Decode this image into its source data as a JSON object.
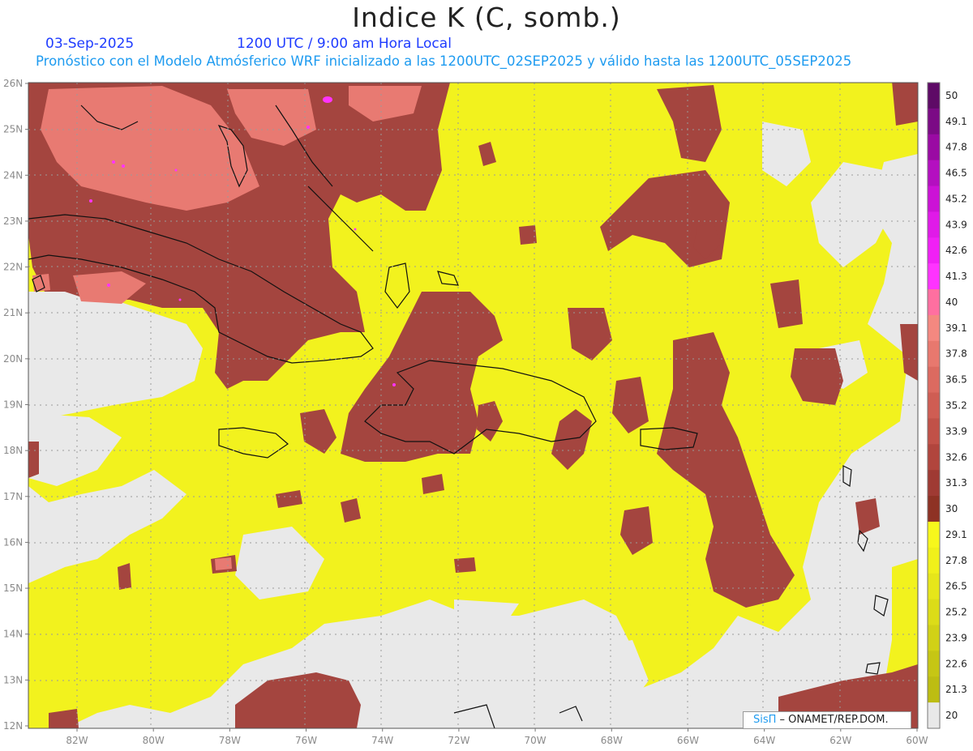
{
  "header": {
    "title": "Indice K (C, somb.)",
    "date": "03-Sep-2025",
    "time": "1200 UTC / 9:00 am Hora Local",
    "forecast": "Pronóstico con el Modelo Atmósferico WRF inicializado a las 1200UTC_02SEP2025 y válido hasta las  1200UTC_05SEP2025"
  },
  "map": {
    "lat_labels": [
      "26N",
      "25N",
      "24N",
      "23N",
      "22N",
      "21N",
      "20N",
      "19N",
      "18N",
      "17N",
      "16N",
      "15N",
      "14N",
      "13N",
      "12N"
    ],
    "lon_labels": [
      "82W",
      "80W",
      "78W",
      "76W",
      "74W",
      "72W",
      "70W",
      "68W",
      "66W",
      "64W",
      "62W",
      "60W"
    ],
    "background_color": "#e9e9e9",
    "moderate_color": "#f2f21e",
    "high_color": "#a4453f",
    "very_high_color": "#e87a72"
  },
  "colorbar": {
    "labels": [
      "50",
      "49.1",
      "47.8",
      "46.5",
      "45.2",
      "43.9",
      "42.6",
      "41.3",
      "40",
      "39.1",
      "37.8",
      "36.5",
      "35.2",
      "33.9",
      "32.6",
      "31.3",
      "30",
      "29.1",
      "27.8",
      "26.5",
      "25.2",
      "23.9",
      "22.6",
      "21.3",
      "20"
    ],
    "colors": [
      "#5e0a66",
      "#7b0a85",
      "#9a0aa3",
      "#b40fc0",
      "#cc12d6",
      "#e01ae8",
      "#f020f5",
      "#ff33ff",
      "#ff6fa0",
      "#f48880",
      "#e8786e",
      "#dc6a60",
      "#cf5d53",
      "#c15148",
      "#b1453d",
      "#9f3a33",
      "#8e3224",
      "#f7f71c",
      "#f0f01a",
      "#e6e61a",
      "#dcdc18",
      "#d1d116",
      "#c6c614",
      "#bdbd12",
      "#e8e8e8"
    ]
  },
  "credit": {
    "logo": "SisΠ",
    "text": " – ONAMET/REP.DOM."
  }
}
